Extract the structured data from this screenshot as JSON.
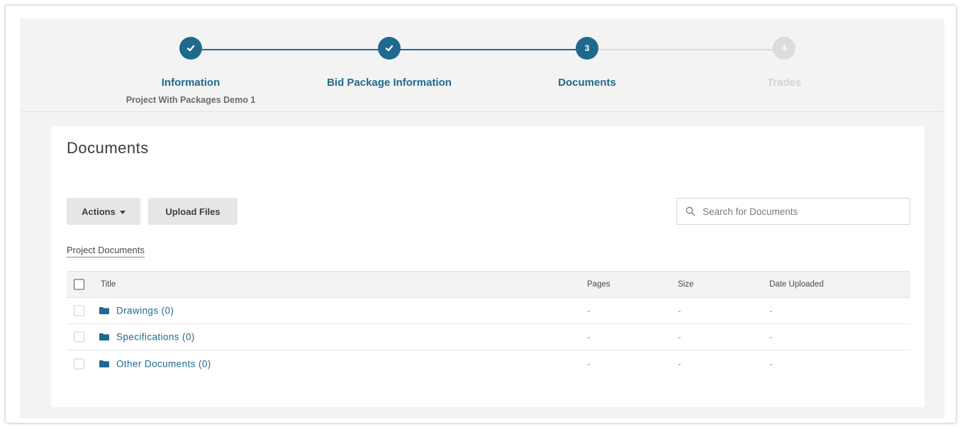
{
  "stepper": {
    "steps": [
      {
        "number": "1",
        "label": "Information",
        "sublabel": "Project With Packages Demo 1",
        "state": "completed"
      },
      {
        "number": "2",
        "label": "Bid Package Information",
        "sublabel": "",
        "state": "completed"
      },
      {
        "number": "3",
        "label": "Documents",
        "sublabel": "",
        "state": "current"
      },
      {
        "number": "4",
        "label": "Trades",
        "sublabel": "",
        "state": "upcoming"
      }
    ]
  },
  "documents": {
    "title": "Documents",
    "actions_label": "Actions",
    "upload_label": "Upload Files",
    "search_placeholder": "Search for Documents",
    "breadcrumb": "Project Documents",
    "columns": {
      "title": "Title",
      "pages": "Pages",
      "size": "Size",
      "date": "Date Uploaded"
    },
    "rows": [
      {
        "title": "Drawings (0)",
        "pages": "-",
        "size": "-",
        "date": "-"
      },
      {
        "title": "Specifications (0)",
        "pages": "-",
        "size": "-",
        "date": "-"
      },
      {
        "title": "Other Documents (0)",
        "pages": "-",
        "size": "-",
        "date": "-"
      }
    ]
  },
  "colors": {
    "accent": "#1e6a8e",
    "inactive": "#dcdcdc",
    "background": "#f3f3f3"
  },
  "icons": {
    "completed_step": "check-icon",
    "folder": "folder-icon",
    "search": "search-icon",
    "dropdown": "caret-down-icon"
  }
}
